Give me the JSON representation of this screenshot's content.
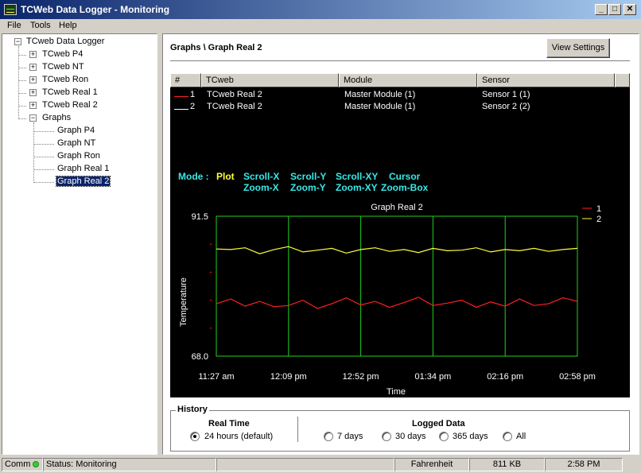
{
  "window": {
    "title": "TCWeb Data Logger - Monitoring",
    "minimize": "_",
    "maximize": "□",
    "close": "✕"
  },
  "menu": [
    "File",
    "Tools",
    "Help"
  ],
  "tree": {
    "root": "TCweb Data Logger",
    "devices": [
      "TCweb P4",
      "TCweb NT",
      "TCweb Ron",
      "TCweb Real 1",
      "TCweb Real 2"
    ],
    "graphs_label": "Graphs",
    "graphs": [
      "Graph P4",
      "Graph NT",
      "Graph Ron",
      "Graph Real 1",
      "Graph Real 2"
    ],
    "selected": "Graph Real 2"
  },
  "main": {
    "title": "Graphs \\ Graph Real 2",
    "view_settings": "View Settings",
    "columns": [
      "#",
      "TCweb",
      "Module",
      "Sensor"
    ],
    "rows": [
      {
        "num": "1",
        "tcweb": "TCweb Real 2",
        "module": "Master Module (1)",
        "sensor": "Sensor 1 (1)",
        "color": "#ff2020"
      },
      {
        "num": "2",
        "tcweb": "TCweb Real 2",
        "module": "Master Module (1)",
        "sensor": "Sensor 2 (2)",
        "color": "#ffffff"
      }
    ],
    "mode": {
      "label": "Mode :",
      "plot": "Plot",
      "options": [
        [
          "Scroll-X",
          "Zoom-X"
        ],
        [
          "Scroll-Y",
          "Zoom-Y"
        ],
        [
          "Scroll-XY",
          "Zoom-XY"
        ],
        [
          "Cursor",
          "Zoom-Box"
        ]
      ]
    }
  },
  "chart_data": {
    "type": "line",
    "title": "Graph Real 2",
    "xlabel": "Time",
    "ylabel": "Temperature",
    "ylim": [
      68.0,
      91.5
    ],
    "y_tick_labels": [
      "91.5",
      "68.0"
    ],
    "x_tick_labels": [
      "11:27 am",
      "12:09 pm",
      "12:52 pm",
      "01:34 pm",
      "02:16 pm",
      "02:58 pm"
    ],
    "legend_position": "top-right",
    "grid": true,
    "series": [
      {
        "name": "1",
        "color": "#ff2020",
        "values": [
          76.8,
          77.6,
          76.4,
          77.2,
          76.3,
          76.5,
          77.4,
          76.0,
          76.8,
          77.8,
          76.6,
          77.2,
          76.2,
          77.0,
          77.9,
          76.5,
          76.9,
          77.4,
          76.2,
          77.1,
          76.4,
          77.6,
          76.5,
          76.8,
          77.8,
          77.2
        ]
      },
      {
        "name": "2",
        "color": "#ffff38",
        "values": [
          86.0,
          85.9,
          86.2,
          85.2,
          85.9,
          86.4,
          85.5,
          85.8,
          86.1,
          85.3,
          85.9,
          86.2,
          85.6,
          85.9,
          85.4,
          86.1,
          85.7,
          85.8,
          86.2,
          85.5,
          85.9,
          85.7,
          86.1,
          85.6,
          85.9,
          86.1
        ]
      }
    ]
  },
  "history": {
    "label": "History",
    "realtime_label": "Real Time",
    "realtime_option": "24 hours (default)",
    "logged_label": "Logged Data",
    "logged_options": [
      "7 days",
      "30 days",
      "365 days",
      "All"
    ]
  },
  "status": {
    "comm": "Comm",
    "status": "Status: Monitoring",
    "empty": "",
    "units": "Fahrenheit",
    "size": "811 KB",
    "time": "2:58 PM"
  }
}
